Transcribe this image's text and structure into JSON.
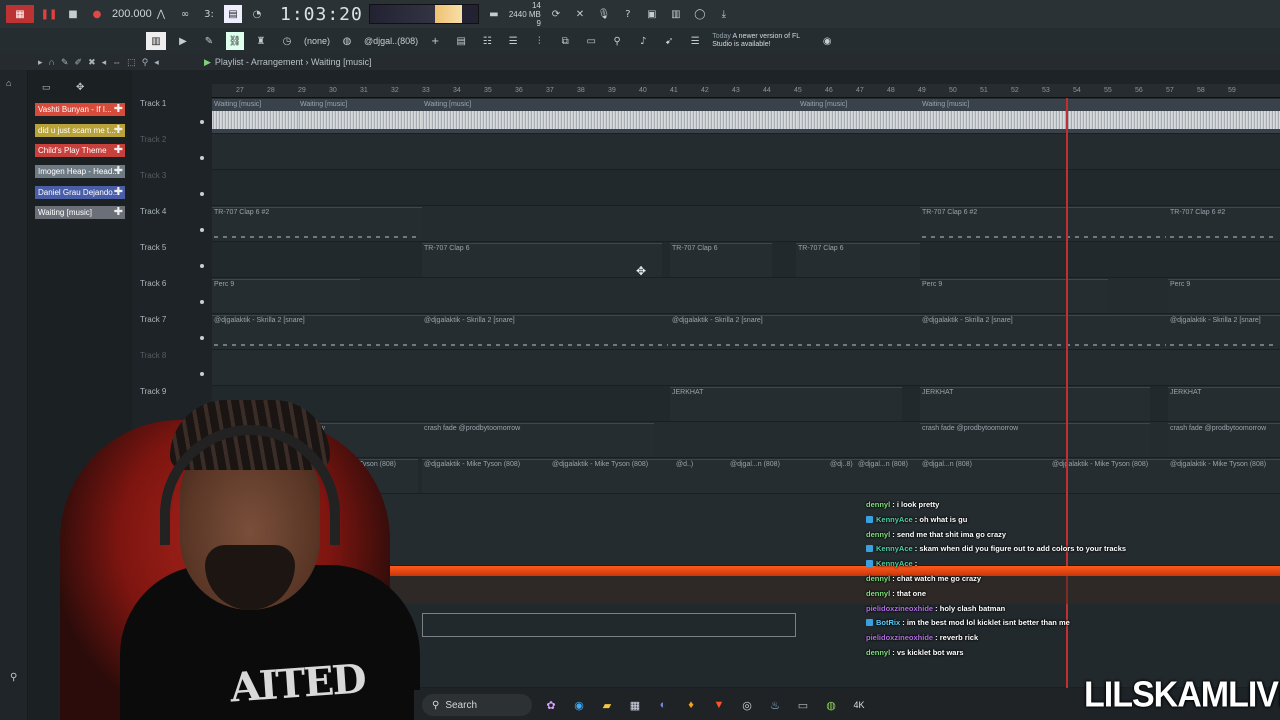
{
  "transport": {
    "tempo": "200.000",
    "timecode": "1:03:20",
    "cpu_top": "14",
    "memory": "2440 MB",
    "voices": "9"
  },
  "toolbar": {
    "pattern_none": "(none)",
    "pattern_name": "@djgal..(808)",
    "update_notice_prefix": "Today",
    "update_notice": "A newer version of FL Studio is available!"
  },
  "playlist": {
    "title": "Playlist - Arrangement",
    "separator": "›",
    "current_clip": "Waiting [music]"
  },
  "picker": [
    {
      "label": "Vashti Bunyan - If I...",
      "color": "#d84a3a"
    },
    {
      "label": "did u just scam me t...",
      "color": "#b8a23a"
    },
    {
      "label": "Child's Play Theme",
      "color": "#c8403c"
    },
    {
      "label": "Imogen Heap - Head...",
      "color": "#6f7b84"
    },
    {
      "label": "Daniel Grau Dejando...",
      "color": "#4a5ea8"
    },
    {
      "label": "Waiting [music]",
      "color": "#6b7078"
    }
  ],
  "tracks": [
    {
      "label": "Track 1"
    },
    {
      "label": "Track 2"
    },
    {
      "label": "Track 3"
    },
    {
      "label": "Track 4"
    },
    {
      "label": "Track 5"
    },
    {
      "label": "Track 6"
    },
    {
      "label": "Track 7"
    },
    {
      "label": "Track 8"
    },
    {
      "label": "Track 9"
    }
  ],
  "ruler": [
    "27",
    "28",
    "29",
    "30",
    "31",
    "32",
    "33",
    "34",
    "35",
    "36",
    "37",
    "38",
    "39",
    "40",
    "41",
    "42",
    "43",
    "44",
    "45",
    "46",
    "47",
    "48",
    "49",
    "50",
    "51",
    "52",
    "53",
    "54",
    "55",
    "56",
    "57",
    "58",
    "59"
  ],
  "clips": {
    "waiting": "Waiting [music]",
    "clap82": "TR-707 Clap 6 #2",
    "clap6": "TR-707 Clap 6",
    "perc": "Perc 9",
    "snare": "@djgalaktik - Skrilla 2 [snare]",
    "jerkhat": "JERKHAT",
    "crash": "crash fade @prodbytoomorrow",
    "tyson_short": "...ke Tyson (808)",
    "tyson": "@djgalaktik - Mike Tyson (808)",
    "tyson_a": "@d..)",
    "tyson_b": "@djgal...n (808)",
    "tyson_c": "@dj..8)",
    "tyson_d": "@djgal...n (808)",
    "tyson_e": "@djgalaktik - Mike Tyson (808)",
    "crash_trunc": "...ow"
  },
  "chat": [
    {
      "user": "dennyl",
      "color": "#7fe07a",
      "badge": "",
      "text": "i look pretty"
    },
    {
      "user": "KennyAce",
      "color": "#4ed0a8",
      "badge": "#3aa0e0",
      "text": "oh what is gu"
    },
    {
      "user": "dennyl",
      "color": "#7fe07a",
      "badge": "",
      "text": "send me that shit ima go crazy"
    },
    {
      "user": "KennyAce",
      "color": "#4ed0a8",
      "badge": "#3aa0e0",
      "text": "skam when did you figure out to add colors to your tracks"
    },
    {
      "user": "KennyAce",
      "color": "#4ed0a8",
      "badge": "#3aa0e0",
      "text": ""
    },
    {
      "user": "dennyl",
      "color": "#7fe07a",
      "badge": "",
      "text": "chat watch me go crazy"
    },
    {
      "user": "dennyl",
      "color": "#7fe07a",
      "badge": "",
      "text": "that one"
    },
    {
      "user": "pielidoxzineoxhide",
      "color": "#b070e0",
      "badge": "",
      "text": "holy clash batman"
    },
    {
      "user": "BotRix",
      "color": "#5ad0ff",
      "badge": "#3aa0e0",
      "text": "im the best mod lol kicklet isnt better than me"
    },
    {
      "user": "pielidoxzineoxhide",
      "color": "#b070e0",
      "badge": "",
      "text": "reverb rick"
    },
    {
      "user": "dennyl",
      "color": "#7fe07a",
      "badge": "",
      "text": "vs kicklet bot wars"
    }
  ],
  "taskbar": {
    "search_label": "Search",
    "apps": [
      "palm-tree",
      "edge",
      "folder",
      "store",
      "discord",
      "fl-studio",
      "brave",
      "chrome",
      "steam",
      "keyboard",
      "ripple",
      "4k"
    ]
  },
  "watermark": "LILSKAMLIVE",
  "shirt_print": "AITED"
}
